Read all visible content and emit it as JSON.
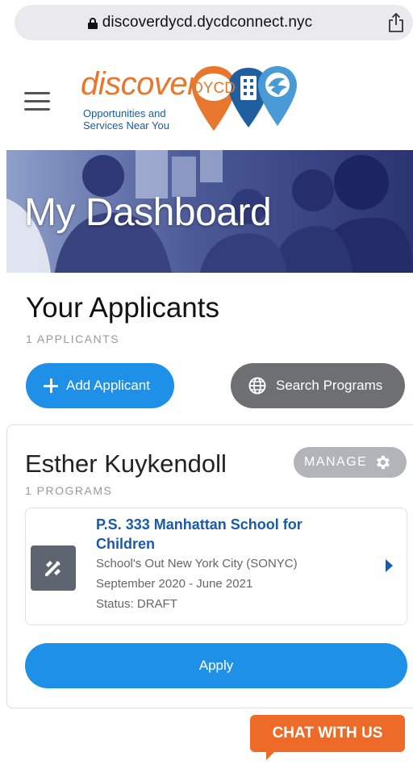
{
  "browser": {
    "url": "discoverdycd.dycdconnect.nyc"
  },
  "header": {
    "logo_word": "discover",
    "logo_badge": "DYCD",
    "logo_tagline_line1": "Opportunities and",
    "logo_tagline_line2": "Services Near You"
  },
  "hero": {
    "title": "My Dashboard"
  },
  "applicants": {
    "title": "Your Applicants",
    "count_label": "1 APPLICANTS",
    "add_button": "Add Applicant",
    "search_button": "Search Programs"
  },
  "applicant": {
    "name": "Esther Kuykendoll",
    "manage_label": "MANAGE",
    "programs_count": "1 PROGRAMS",
    "program": {
      "title": "P.S. 333 Manhattan School for Children",
      "provider": "School's Out New York City (SONYC)",
      "dates": "September 2020 - June 2021",
      "status": "Status: DRAFT"
    },
    "apply_button": "Apply"
  },
  "chat": {
    "label": "CHAT WITH US"
  },
  "colors": {
    "brand_orange": "#e8762d",
    "brand_blue": "#1a5a9e",
    "button_blue": "#1e90e8",
    "button_gray": "#6d6f73",
    "chat_orange": "#ee6a28"
  },
  "icons": [
    "lock-icon",
    "share-icon",
    "hamburger-menu-icon",
    "plus-icon",
    "globe-icon",
    "gear-icon",
    "pencil-ruler-icon",
    "chevron-right-icon"
  ]
}
